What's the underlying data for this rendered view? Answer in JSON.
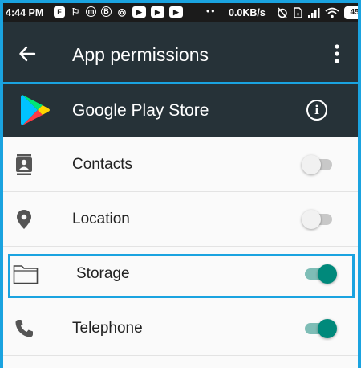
{
  "status_bar": {
    "time": "4:44 PM",
    "speed": "0.0KB/s",
    "battery": "45",
    "notif_icons": [
      "F",
      "⚐",
      "m",
      "B",
      "◎",
      "▶",
      "▶",
      "▶"
    ]
  },
  "app_bar": {
    "title": "App permissions"
  },
  "app_header": {
    "name": "Google Play Store",
    "info_symbol": "i"
  },
  "permissions": [
    {
      "label": "Contacts",
      "enabled": false,
      "icon": "contacts-icon"
    },
    {
      "label": "Location",
      "enabled": false,
      "icon": "location-icon"
    },
    {
      "label": "Storage",
      "enabled": true,
      "icon": "folder-icon",
      "highlighted": true
    },
    {
      "label": "Telephone",
      "enabled": true,
      "icon": "phone-icon"
    }
  ],
  "colors": {
    "header_bg": "#263238",
    "accent_blue": "#1aa3e0",
    "toggle_on": "#00897b",
    "list_bg": "#fafafa"
  }
}
